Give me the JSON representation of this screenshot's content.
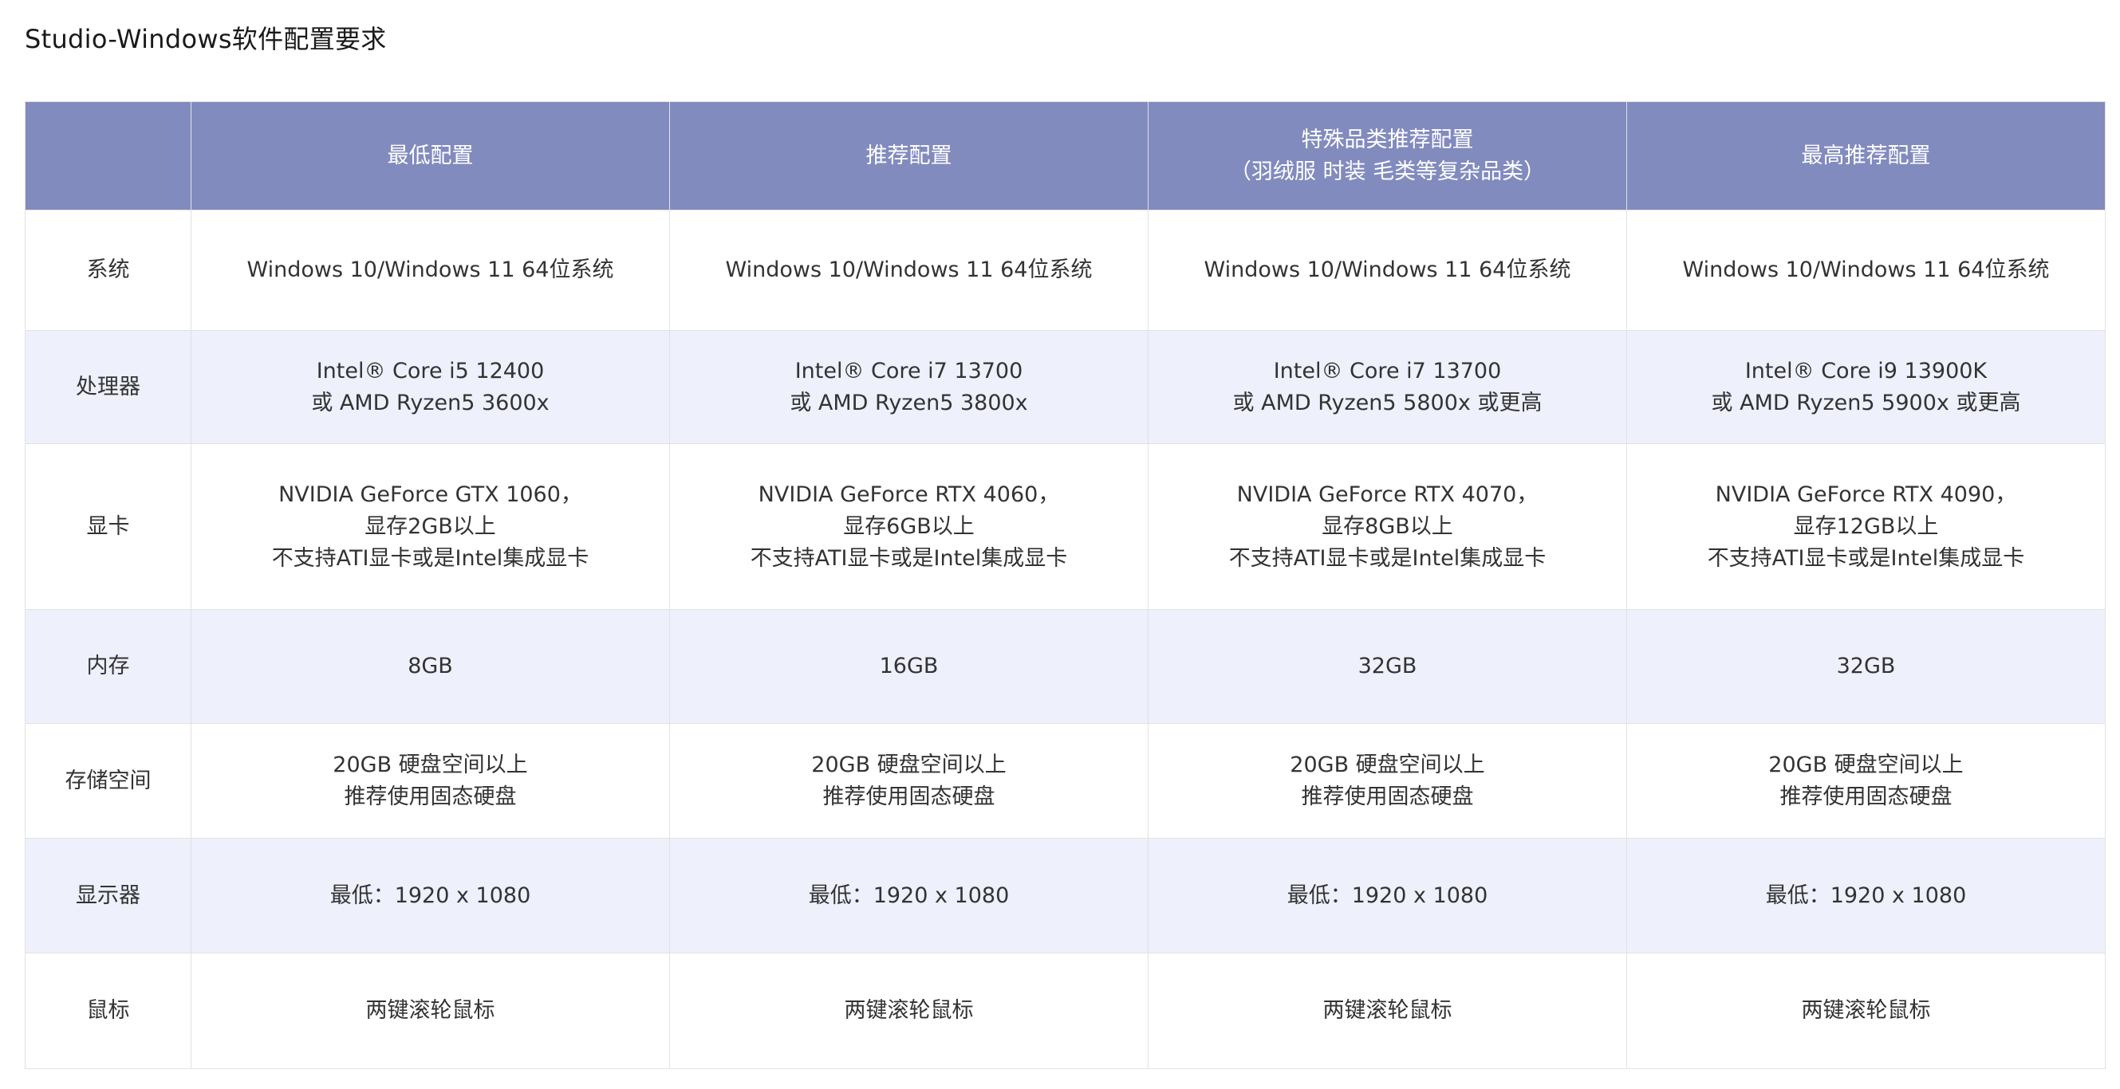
{
  "title": "Studio-Windows软件配置要求",
  "colors": {
    "header_bg": "#828bbe",
    "header_text": "#ffffff",
    "alt_row_bg": "#eef0fc",
    "border": "#e2e2e2"
  },
  "header": {
    "corner": "",
    "cols": [
      {
        "lines": [
          "最低配置"
        ]
      },
      {
        "lines": [
          "推荐配置"
        ]
      },
      {
        "lines": [
          "特殊品类推荐配置",
          "（羽绒服 时装 毛类等复杂品类）"
        ]
      },
      {
        "lines": [
          "最高推荐配置"
        ]
      }
    ]
  },
  "rows": [
    {
      "label": "系统",
      "cells": [
        {
          "lines": [
            "Windows 10/Windows 11 64位系统"
          ]
        },
        {
          "lines": [
            "Windows 10/Windows 11 64位系统"
          ]
        },
        {
          "lines": [
            "Windows 10/Windows 11 64位系统"
          ]
        },
        {
          "lines": [
            "Windows 10/Windows 11 64位系统"
          ]
        }
      ]
    },
    {
      "label": "处理器",
      "cells": [
        {
          "lines": [
            "Intel® Core i5 12400",
            "或 AMD Ryzen5 3600x"
          ]
        },
        {
          "lines": [
            "Intel® Core i7 13700",
            "或 AMD Ryzen5 3800x"
          ]
        },
        {
          "lines": [
            "Intel® Core i7 13700",
            "或 AMD Ryzen5 5800x 或更高"
          ]
        },
        {
          "lines": [
            "Intel® Core i9 13900K",
            "或 AMD Ryzen5 5900x 或更高"
          ]
        }
      ]
    },
    {
      "label": "显卡",
      "cells": [
        {
          "lines": [
            "NVIDIA GeForce GTX 1060，",
            "显存2GB以上",
            "不支持ATI显卡或是Intel集成显卡"
          ]
        },
        {
          "lines": [
            "NVIDIA GeForce RTX 4060，",
            "显存6GB以上",
            "不支持ATI显卡或是Intel集成显卡"
          ]
        },
        {
          "lines": [
            "NVIDIA GeForce RTX 4070，",
            "显存8GB以上",
            "不支持ATI显卡或是Intel集成显卡"
          ]
        },
        {
          "lines": [
            "NVIDIA GeForce RTX 4090，",
            "显存12GB以上",
            "不支持ATI显卡或是Intel集成显卡"
          ]
        }
      ]
    },
    {
      "label": "内存",
      "cells": [
        {
          "lines": [
            "8GB"
          ]
        },
        {
          "lines": [
            "16GB"
          ]
        },
        {
          "lines": [
            "32GB"
          ]
        },
        {
          "lines": [
            "32GB"
          ]
        }
      ]
    },
    {
      "label": "存储空间",
      "cells": [
        {
          "lines": [
            "20GB 硬盘空间以上",
            "推荐使用固态硬盘"
          ]
        },
        {
          "lines": [
            "20GB 硬盘空间以上",
            "推荐使用固态硬盘"
          ]
        },
        {
          "lines": [
            "20GB 硬盘空间以上",
            "推荐使用固态硬盘"
          ]
        },
        {
          "lines": [
            "20GB 硬盘空间以上",
            "推荐使用固态硬盘"
          ]
        }
      ]
    },
    {
      "label": "显示器",
      "cells": [
        {
          "lines": [
            "最低：1920 x 1080"
          ]
        },
        {
          "lines": [
            "最低：1920 x 1080"
          ]
        },
        {
          "lines": [
            "最低：1920 x 1080"
          ]
        },
        {
          "lines": [
            "最低：1920 x 1080"
          ]
        }
      ]
    },
    {
      "label": "鼠标",
      "cells": [
        {
          "lines": [
            "两键滚轮鼠标"
          ]
        },
        {
          "lines": [
            "两键滚轮鼠标"
          ]
        },
        {
          "lines": [
            "两键滚轮鼠标"
          ]
        },
        {
          "lines": [
            "两键滚轮鼠标"
          ]
        }
      ]
    }
  ]
}
